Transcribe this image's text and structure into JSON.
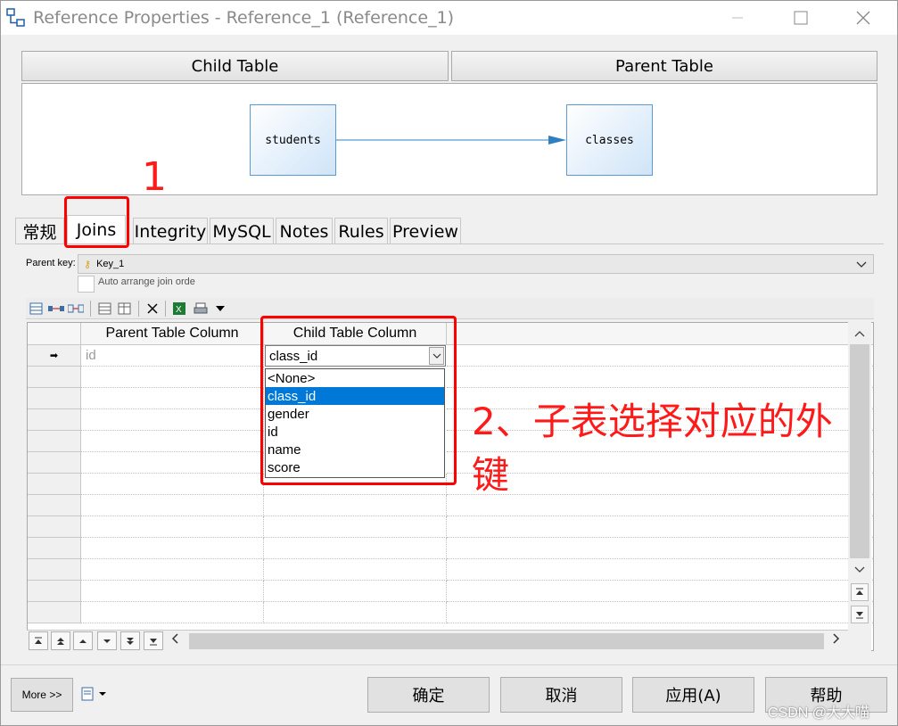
{
  "window": {
    "title": "Reference Properties - Reference_1 (Reference_1)"
  },
  "header": {
    "child_table": "Child Table",
    "parent_table": "Parent Table"
  },
  "diagram": {
    "child_table_name": "students",
    "parent_table_name": "classes"
  },
  "tabs": [
    {
      "label": "常规"
    },
    {
      "label": "Joins"
    },
    {
      "label": "Integrity"
    },
    {
      "label": "MySQL"
    },
    {
      "label": "Notes"
    },
    {
      "label": "Rules"
    },
    {
      "label": "Preview"
    }
  ],
  "parent_key": {
    "label": "Parent key:",
    "value": "Key_1"
  },
  "auto_arrange": {
    "label": "Auto arrange join orde"
  },
  "grid": {
    "columns": [
      "Parent Table Column",
      "Child Table Column"
    ],
    "row": {
      "parent_column": "id",
      "child_column": "class_id"
    },
    "dropdown_options": [
      "<None>",
      "class_id",
      "gender",
      "id",
      "name",
      "score"
    ],
    "selected_option": "class_id"
  },
  "buttons": {
    "more": "More >>",
    "ok": "确定",
    "cancel": "取消",
    "apply": "应用(A)",
    "help": "帮助"
  },
  "annotations": {
    "step1": "1",
    "step2_line1": "2、子表选择对应的外",
    "step2_line2": "键",
    "color": "#ff0000"
  },
  "watermark": "CSDN @大大喵"
}
